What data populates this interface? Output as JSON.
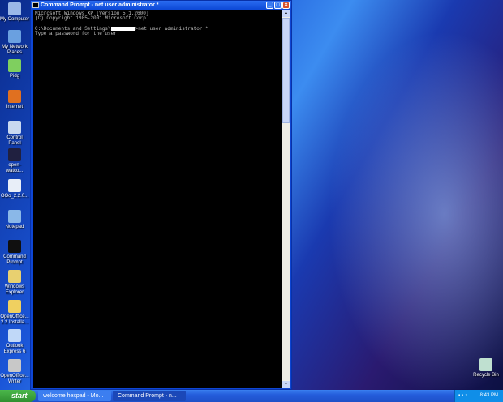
{
  "desktop": {
    "icons": [
      {
        "label": "My Computer",
        "icon": "computer-icon",
        "color": "#9bb8e8"
      },
      {
        "label": "My Network Places",
        "icon": "network-icon",
        "color": "#6aa0e0"
      },
      {
        "label": "Pidg",
        "icon": "pidgin-icon",
        "color": "#7fcf5f"
      },
      {
        "label": "Internet",
        "icon": "firefox-icon",
        "color": "#e07020"
      },
      {
        "label": "Control Panel",
        "icon": "control-panel-icon",
        "color": "#c8d8f0"
      },
      {
        "label": "open-watco...",
        "icon": "floppy-icon",
        "color": "#202040"
      },
      {
        "label": "OOo_2.2.0...",
        "icon": "installer-icon",
        "color": "#e8eef8"
      },
      {
        "label": "Notepad",
        "icon": "notepad-icon",
        "color": "#8ab8e8"
      },
      {
        "label": "Command Prompt",
        "icon": "command-prompt-icon",
        "color": "#101010"
      },
      {
        "label": "Windows Explorer",
        "icon": "explorer-icon",
        "color": "#e8d070"
      },
      {
        "label": "OpenOffice... 2.2 Installa...",
        "icon": "folder-icon",
        "color": "#f0d060"
      },
      {
        "label": "Outlook Express 6",
        "icon": "outlook-icon",
        "color": "#c0d8f8"
      },
      {
        "label": "OpenOffice... Writer",
        "icon": "writer-icon",
        "color": "#c8c8c8"
      }
    ],
    "recycle_bin": "Recycle Bin"
  },
  "window": {
    "title": "Command Prompt - net user administrator *",
    "lines": [
      "Microsoft Windows XP [Version 5.1.2600]",
      "(C) Copyright 1985-2001 Microsoft Corp.",
      "",
      "C:\\Documents and Settings\\"
    ],
    "cmd_suffix": ">net user administrator *",
    "prompt": "Type a password for the user:"
  },
  "taskbar": {
    "start": "start",
    "tasks": [
      "welcome hexpad - Mo...",
      "Command Prompt - n..."
    ],
    "clock": "8:43 PM"
  }
}
